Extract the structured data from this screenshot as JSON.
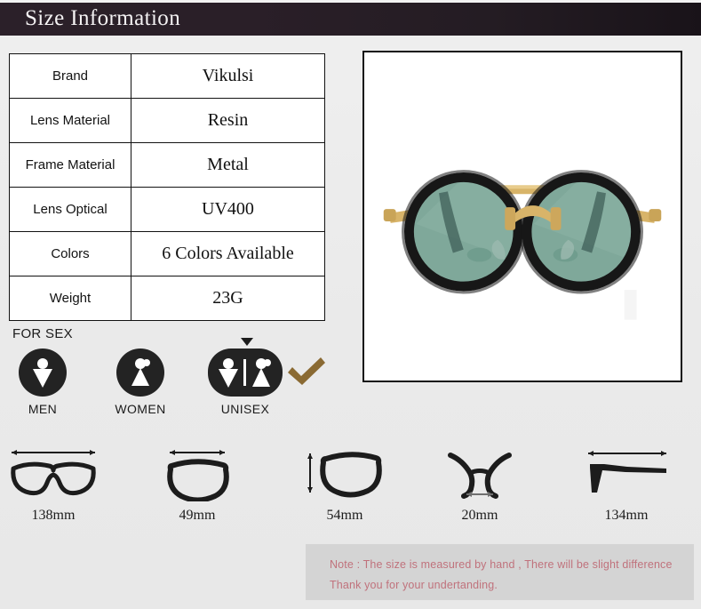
{
  "header": {
    "title": "Size Information"
  },
  "spec_table": {
    "rows": [
      {
        "key": "Brand",
        "value": "Vikulsi"
      },
      {
        "key": "Lens Material",
        "value": "Resin"
      },
      {
        "key": "Frame Material",
        "value": "Metal"
      },
      {
        "key": "Lens Optical",
        "value": "UV400"
      },
      {
        "key": "Colors",
        "value": "6 Colors Available"
      },
      {
        "key": "Weight",
        "value": "23G"
      }
    ]
  },
  "product_image": {
    "alt": "round double-bridge sunglasses",
    "lens_color": "#7fa89a",
    "lens_color_dark": "#5f8c7c",
    "frame_metal_color": "#d8b469",
    "frame_rim_color": "#171717",
    "background": "#ffffff"
  },
  "for_sex": {
    "label": "FOR SEX",
    "options": [
      {
        "name": "MEN",
        "icon": "male-figure-icon",
        "selected": false
      },
      {
        "name": "WOMEN",
        "icon": "female-figure-icon",
        "selected": false
      },
      {
        "name": "UNISEX",
        "icon": "unisex-figures-icon",
        "selected": true
      }
    ],
    "selected": "UNISEX",
    "check_color": "#8a6a33",
    "badge_color": "#232323"
  },
  "measurements": [
    {
      "label": "138mm",
      "icon": "frame-total-width-icon",
      "dimension": "frame width",
      "value": 138,
      "unit": "mm"
    },
    {
      "label": "49mm",
      "icon": "lens-width-icon",
      "dimension": "lens width",
      "value": 49,
      "unit": "mm"
    },
    {
      "label": "54mm",
      "icon": "lens-height-icon",
      "dimension": "lens height",
      "value": 54,
      "unit": "mm"
    },
    {
      "label": "20mm",
      "icon": "bridge-width-icon",
      "dimension": "bridge width",
      "value": 20,
      "unit": "mm"
    },
    {
      "label": "134mm",
      "icon": "temple-length-icon",
      "dimension": "temple length",
      "value": 134,
      "unit": "mm"
    }
  ],
  "note": {
    "line1": "Note : The size is measured by hand , There will be slight difference",
    "line2": "Thank you for your undertanding.",
    "text_color": "#c0727c",
    "background": "#d4d4d4"
  }
}
